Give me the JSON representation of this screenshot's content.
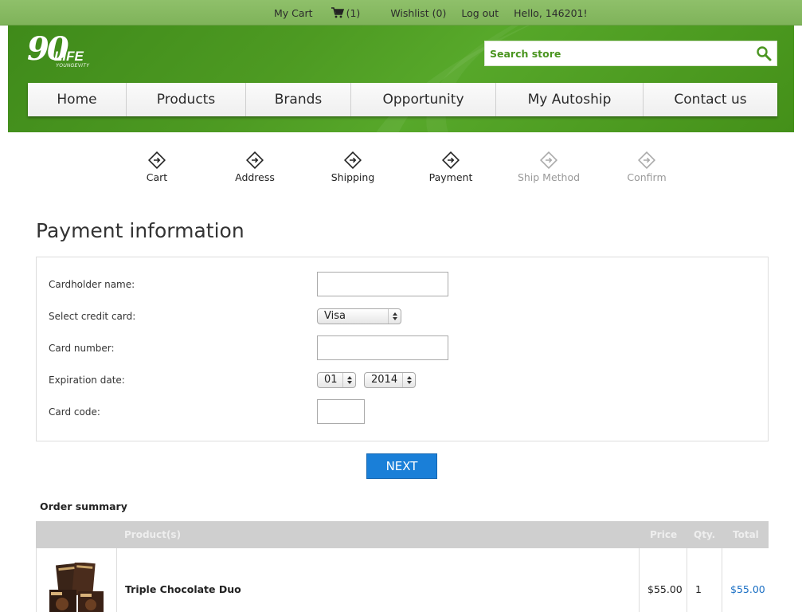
{
  "topbar": {
    "cart": "My Cart",
    "cart_count": "(1)",
    "wishlist": "Wishlist (0)",
    "logout": "Log out",
    "greeting": "Hello, 146201!"
  },
  "logo": {
    "number": "90",
    "word": "LIFE",
    "tagline": "YOUNGEVITY"
  },
  "search": {
    "placeholder": "Search store"
  },
  "nav": [
    "Home",
    "Products",
    "Brands",
    "Opportunity",
    "My Autoship",
    "Contact us"
  ],
  "steps": [
    {
      "label": "Cart",
      "active": true
    },
    {
      "label": "Address",
      "active": true
    },
    {
      "label": "Shipping",
      "active": true
    },
    {
      "label": "Payment",
      "active": true
    },
    {
      "label": "Ship Method",
      "active": false
    },
    {
      "label": "Confirm",
      "active": false
    }
  ],
  "page_title": "Payment information",
  "form": {
    "cardholder_label": "Cardholder name:",
    "cardholder_value": "",
    "card_type_label": "Select credit card:",
    "card_type_value": "Visa",
    "card_number_label": "Card number:",
    "card_number_value": "",
    "expiration_label": "Expiration date:",
    "exp_month": "01",
    "exp_separator": "/",
    "exp_year": "2014",
    "card_code_label": "Card code:",
    "card_code_value": ""
  },
  "next_button": "NEXT",
  "order_summary": {
    "title": "Order summary",
    "headers": {
      "product": "Product(s)",
      "price": "Price",
      "qty": "Qty.",
      "total": "Total"
    },
    "rows": [
      {
        "name": "Triple Chocolate Duo",
        "price": "$55.00",
        "qty": "1",
        "total": "$55.00"
      }
    ]
  },
  "colors": {
    "brand_green": "#4d9a22",
    "button_blue": "#1a7fd8",
    "link_blue": "#1a6fc4"
  }
}
